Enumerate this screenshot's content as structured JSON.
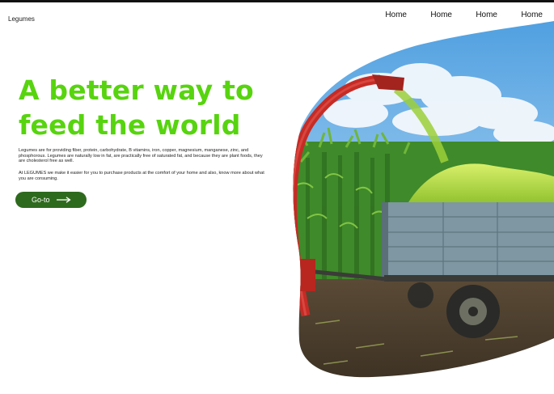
{
  "header": {
    "brand": "Legumes",
    "nav": [
      "Home",
      "Home",
      "Home",
      "Home"
    ]
  },
  "hero": {
    "title_line1": "A better way to",
    "title_line2": "feed the world",
    "paragraph1": "Legumes are for providing fiber, protein, carbohydrate, B vitamins, iron, copper, magnesium, manganese, zinc, and phosphorous. Legumes are naturally low in fat, are practically free of saturated fat, and because they are plant foods, they are cholesterol free as well.",
    "paragraph2": "At LEGUMES we make it easier for you to purchase products at the comfort of your home and also, know more about what you are consuming.",
    "cta_label": "Go-to"
  },
  "colors": {
    "title_green": "#57d40f",
    "button_green": "#2e6a1d"
  },
  "icons": {
    "cta_icon": "arrow-right-icon"
  }
}
